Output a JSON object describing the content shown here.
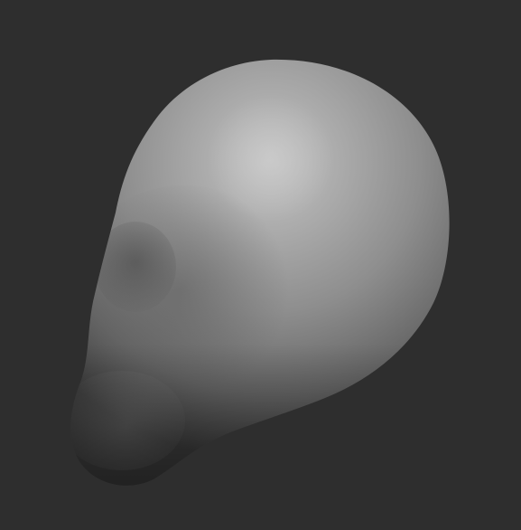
{
  "viewport": {
    "background_color": "#2e2e2e",
    "model": {
      "shape": "head-sculpt-base-mesh",
      "material_color": "#8a8a8a",
      "highlight_color": "#c2c2c2",
      "shadow_color": "#1c1c1c"
    }
  }
}
